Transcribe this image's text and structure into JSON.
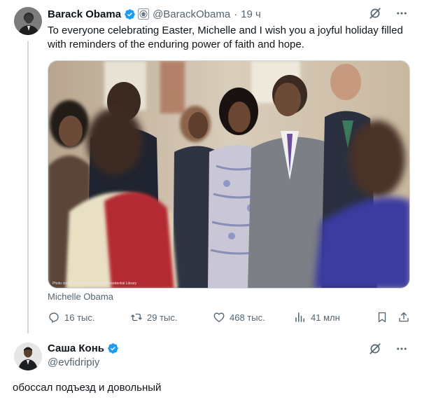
{
  "tweet": {
    "author_name": "Barack Obama",
    "author_handle": "@BarackObama",
    "separator": "·",
    "time": "19 ч",
    "text": "To everyone celebrating Easter, Michelle and I wish you a joyful holiday filled with reminders of the enduring power of faith and hope.",
    "photo_credit": "Photo credit: Pete Souza / Obama Presidential Library",
    "media_caption": "Michelle Obama",
    "stats": {
      "replies": "16 тыс.",
      "reposts": "29 тыс.",
      "likes": "468 тыс.",
      "views": "41 млн"
    }
  },
  "reply": {
    "author_name": "Саша Конь",
    "author_handle": "@evfidripiy",
    "text": "обоссал подъезд и довольный"
  },
  "icons": {
    "verified": "verified-badge-icon",
    "government": "government-seal-icon",
    "grok": "grok-icon",
    "more": "more-icon",
    "reply": "reply-icon",
    "repost": "repost-icon",
    "like": "like-icon",
    "views": "views-icon",
    "bookmark": "bookmark-icon",
    "share": "share-icon"
  },
  "colors": {
    "verified_blue": "#1d9bf0",
    "secondary_text": "#536471",
    "thread_line": "#cfd9de"
  }
}
